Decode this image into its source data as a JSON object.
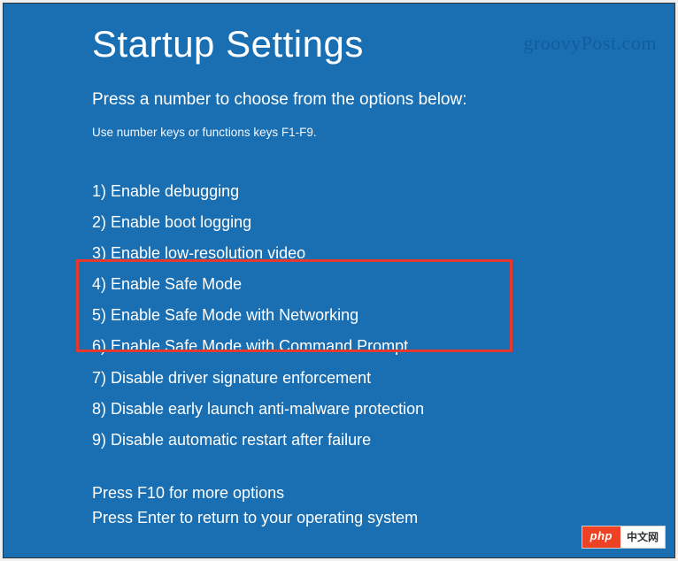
{
  "title": "Startup Settings",
  "subtitle": "Press a number to choose from the options below:",
  "hint": "Use number keys or functions keys F1-F9.",
  "options": [
    "1) Enable debugging",
    "2) Enable boot logging",
    "3) Enable low-resolution video",
    "4) Enable Safe Mode",
    "5) Enable Safe Mode with Networking",
    "6) Enable Safe Mode with Command Prompt",
    "7) Disable driver signature enforcement",
    "8) Disable early launch anti-malware protection",
    "9) Disable automatic restart after failure"
  ],
  "footer": {
    "line1": "Press F10 for more options",
    "line2": "Press Enter to return to your operating system"
  },
  "watermark_gp": "groovyPost.com",
  "watermark_php": {
    "left": "php",
    "right": "中文网"
  }
}
